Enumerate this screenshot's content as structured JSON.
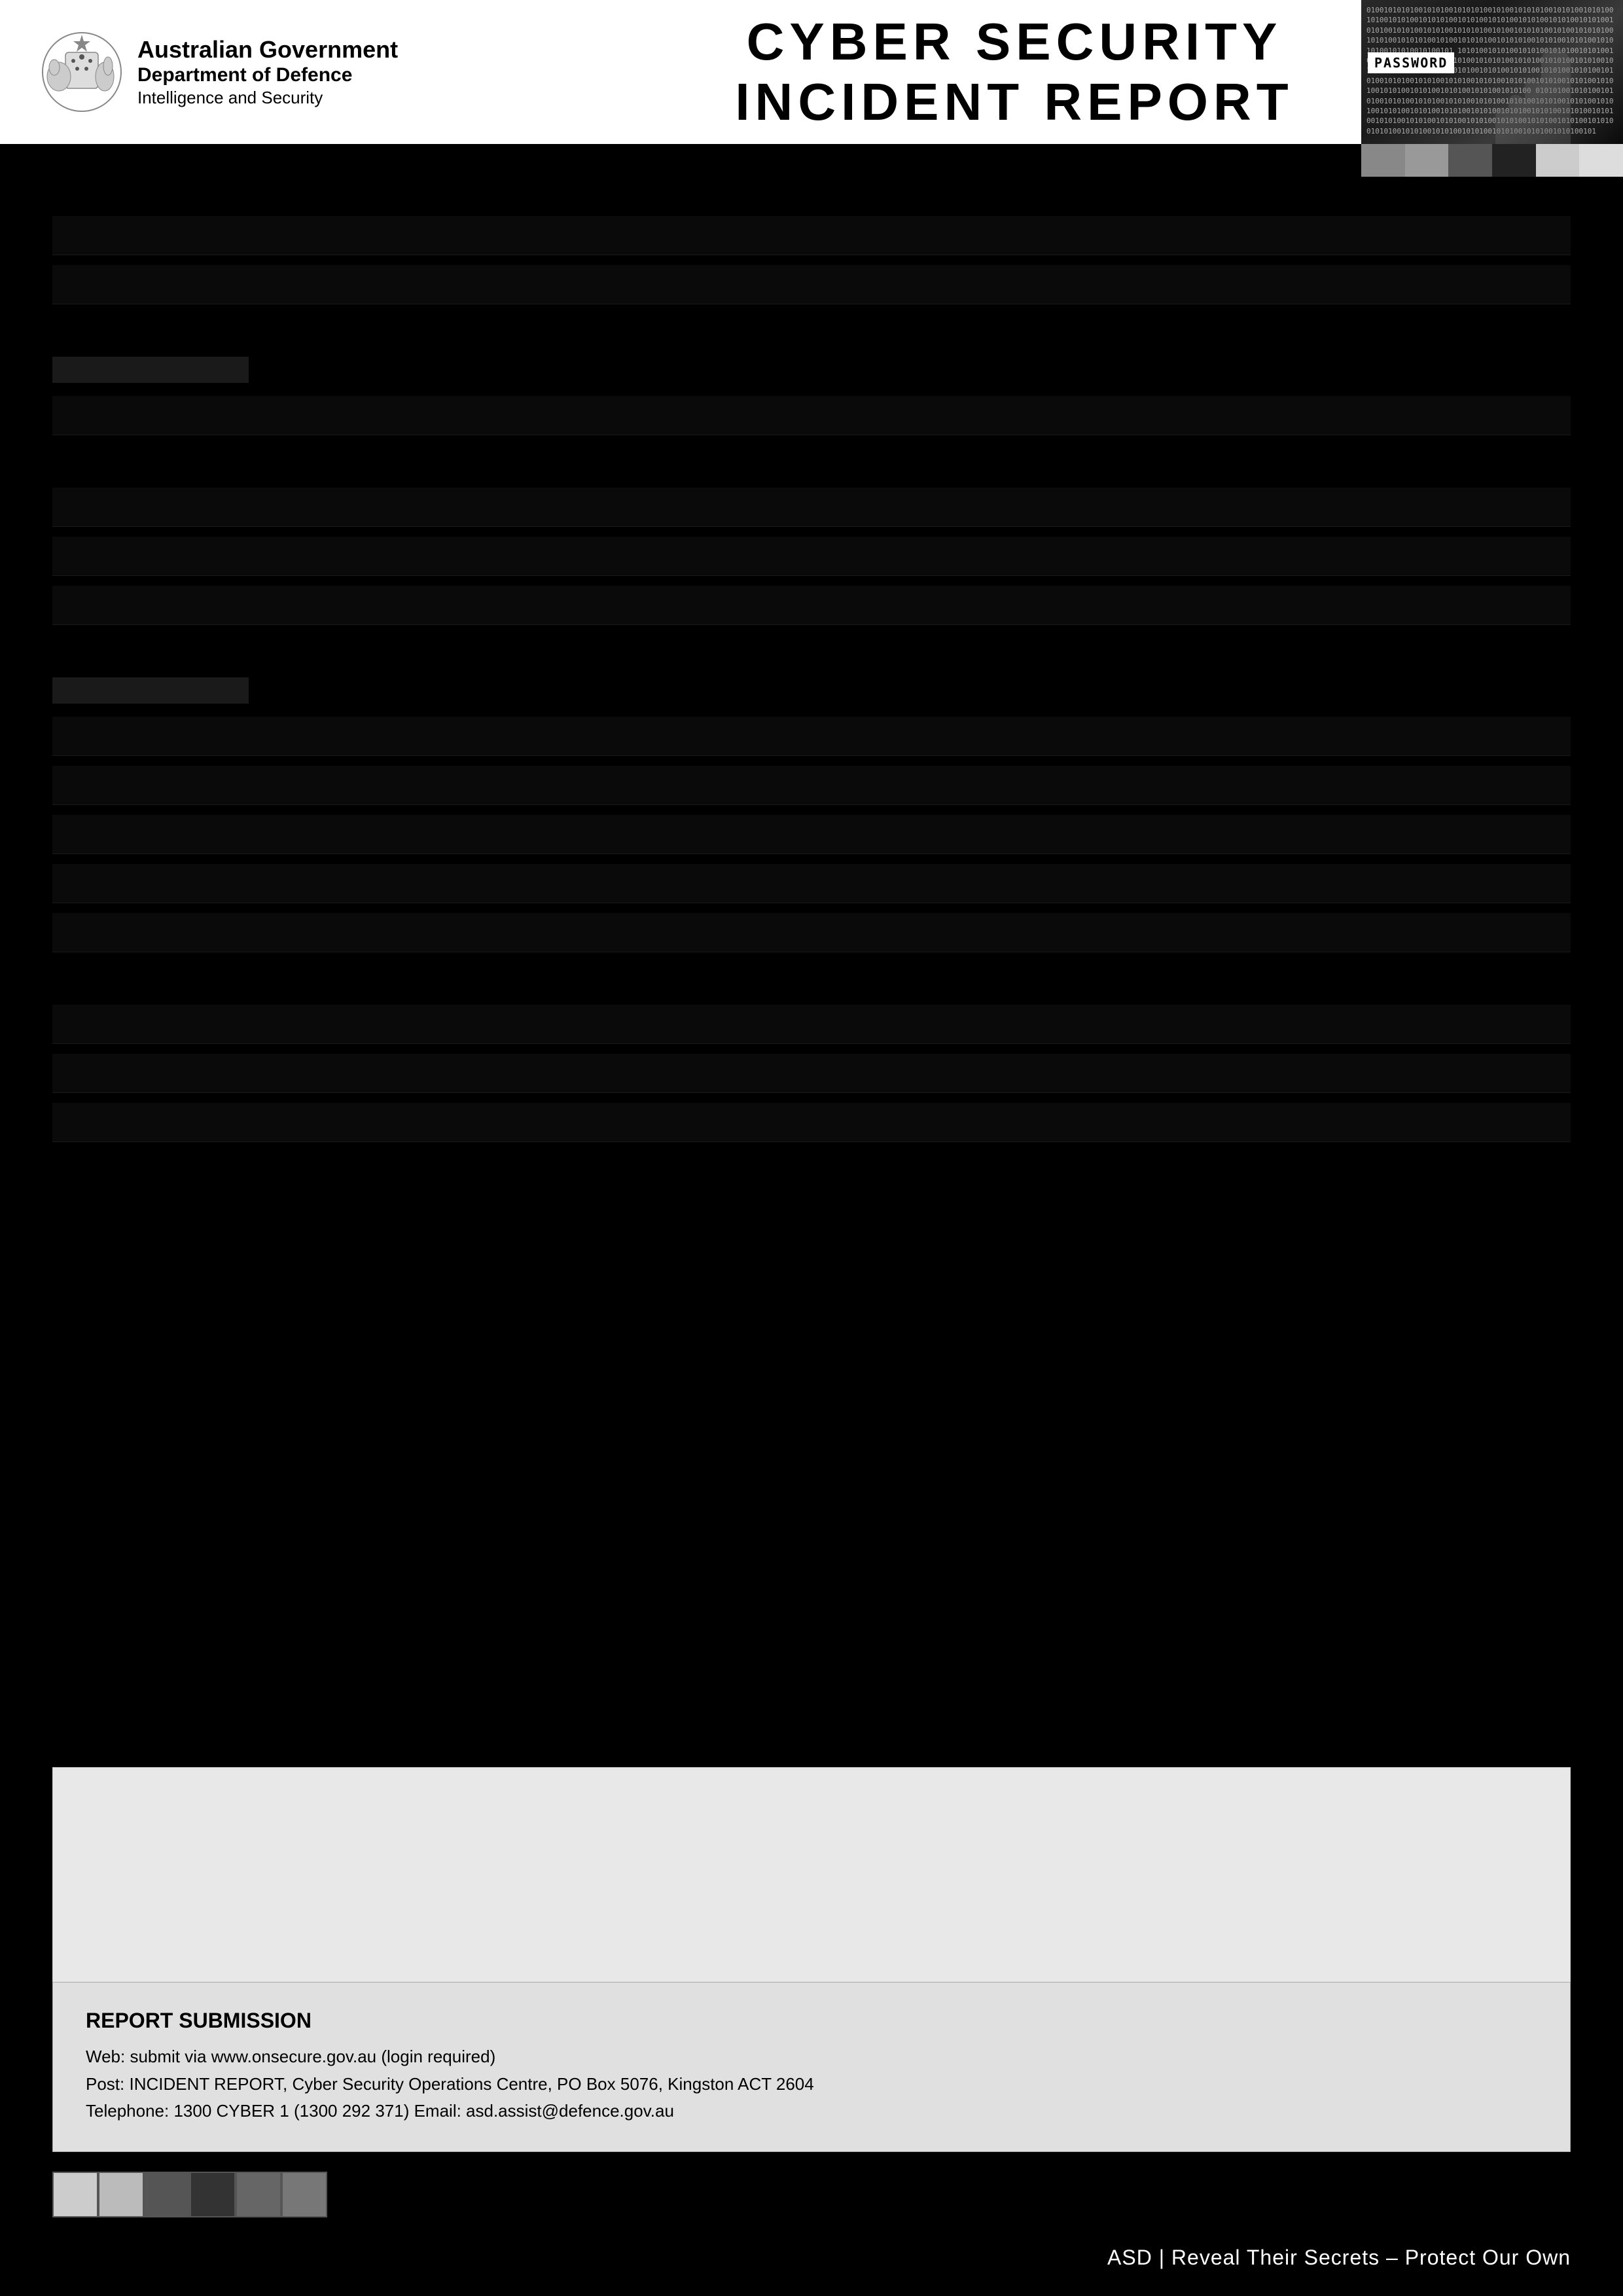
{
  "header": {
    "gov_line1": "Australian Government",
    "gov_line2": "Department of Defence",
    "gov_line3": "Intelligence and Security",
    "report_title_line1": "CYBER SECURITY",
    "report_title_line2": "INCIDENT REPORT"
  },
  "color_strip_top": {
    "boxes": [
      {
        "color": "#888888"
      },
      {
        "color": "#999999"
      },
      {
        "color": "#555555"
      },
      {
        "color": "#222222"
      },
      {
        "color": "#cccccc"
      },
      {
        "color": "#dddddd"
      }
    ]
  },
  "color_strip_bottom": {
    "boxes": [
      {
        "color": "#cccccc"
      },
      {
        "color": "#bbbbbb"
      },
      {
        "color": "#555555"
      },
      {
        "color": "#333333"
      },
      {
        "color": "#666666"
      },
      {
        "color": "#777777"
      }
    ]
  },
  "submission": {
    "title": "REPORT SUBMISSION",
    "web_line": "Web: submit via www.onsecure.gov.au (login required)",
    "post_line": "Post: INCIDENT REPORT, Cyber Security Operations Centre, PO Box 5076, Kingston ACT 2604",
    "phone_line": "Telephone: 1300 CYBER 1 (1300 292 371)  Email: asd.assist@defence.gov.au"
  },
  "footer": {
    "tagline": "ASD | Reveal Their Secrets – Protect Our Own"
  },
  "binary_sample": "101010010101001010101001010100101010100101010010101010010101001010101001010100101010100101001010110101001010100101010001010110101001010010101010010101010010101001010100101010100101010010101001010100010101101010010101001010100010101101010010100101010",
  "password_text": "PASSWORD"
}
